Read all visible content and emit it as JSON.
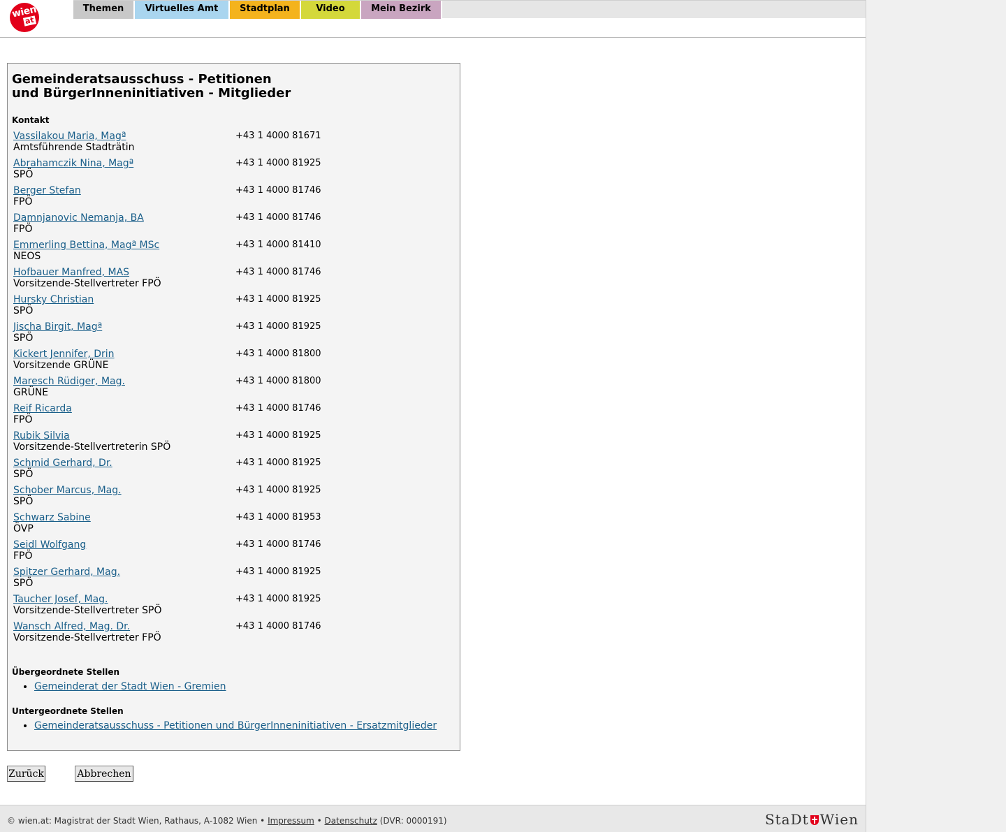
{
  "header": {
    "logo_top": "wien",
    "logo_bottom": "at",
    "nav": [
      "Themen",
      "Virtuelles Amt",
      "Stadtplan",
      "Video",
      "Mein Bezirk"
    ]
  },
  "main": {
    "title": "Gemeinderatsausschuss - Petitionen und BürgerInneninitiativen - Mitglieder",
    "contact_label": "Kontakt",
    "members": [
      {
        "name": "Vassilakou Maria, Magª",
        "role": "Amtsführende Stadträtin",
        "phone": "+43 1 4000 81671"
      },
      {
        "name": "Abrahamczik Nina, Magª",
        "role": "SPÖ",
        "phone": "+43 1 4000 81925"
      },
      {
        "name": "Berger Stefan",
        "role": "FPÖ",
        "phone": "+43 1 4000 81746"
      },
      {
        "name": "Damnjanovic Nemanja, BA",
        "role": "FPÖ",
        "phone": "+43 1 4000 81746"
      },
      {
        "name": "Emmerling Bettina, Magª MSc",
        "role": "NEOS",
        "phone": "+43 1 4000 81410"
      },
      {
        "name": "Hofbauer Manfred, MAS",
        "role": "Vorsitzende-Stellvertreter FPÖ",
        "phone": "+43 1 4000 81746"
      },
      {
        "name": "Hursky Christian",
        "role": "SPÖ",
        "phone": "+43 1 4000 81925"
      },
      {
        "name": "Jischa Birgit, Magª",
        "role": "SPÖ",
        "phone": "+43 1 4000 81925"
      },
      {
        "name": "Kickert Jennifer, Drin",
        "role": "Vorsitzende GRÜNE",
        "phone": "+43 1 4000 81800"
      },
      {
        "name": "Maresch Rüdiger, Mag.",
        "role": "GRÜNE",
        "phone": "+43 1 4000 81800"
      },
      {
        "name": "Reif Ricarda",
        "role": "FPÖ",
        "phone": "+43 1 4000 81746"
      },
      {
        "name": "Rubik Silvia",
        "role": "Vorsitzende-Stellvertreterin SPÖ",
        "phone": "+43 1 4000 81925"
      },
      {
        "name": "Schmid Gerhard, Dr.",
        "role": "SPÖ",
        "phone": "+43 1 4000 81925"
      },
      {
        "name": "Schober Marcus, Mag.",
        "role": "SPÖ",
        "phone": "+43 1 4000 81925"
      },
      {
        "name": "Schwarz Sabine",
        "role": "ÖVP",
        "phone": "+43 1 4000 81953"
      },
      {
        "name": "Seidl Wolfgang",
        "role": "FPÖ",
        "phone": "+43 1 4000 81746"
      },
      {
        "name": "Spitzer Gerhard, Mag.",
        "role": "SPÖ",
        "phone": "+43 1 4000 81925"
      },
      {
        "name": "Taucher Josef, Mag.",
        "role": "Vorsitzende-Stellvertreter SPÖ",
        "phone": "+43 1 4000 81925"
      },
      {
        "name": "Wansch Alfred, Mag. Dr.",
        "role": "Vorsitzende-Stellvertreter FPÖ",
        "phone": "+43 1 4000 81746"
      }
    ],
    "parent_label": "Übergeordnete Stellen",
    "parent_links": [
      "Gemeinderat der Stadt Wien - Gremien"
    ],
    "child_label": "Untergeordnete Stellen",
    "child_links": [
      "Gemeinderatsausschuss - Petitionen und BürgerInneninitiativen - Ersatzmitglieder"
    ]
  },
  "buttons": {
    "back": "Zurück",
    "cancel": "Abbrechen"
  },
  "footer": {
    "copyright": "© wien.at: Magistrat der Stadt Wien, Rathaus, A-1082 Wien •",
    "impressum": "Impressum",
    "sep": "•",
    "datenschutz": "Datenschutz",
    "dvr": "(DVR: 0000191)",
    "logo_left": "StaDt",
    "logo_right": "Wien"
  }
}
